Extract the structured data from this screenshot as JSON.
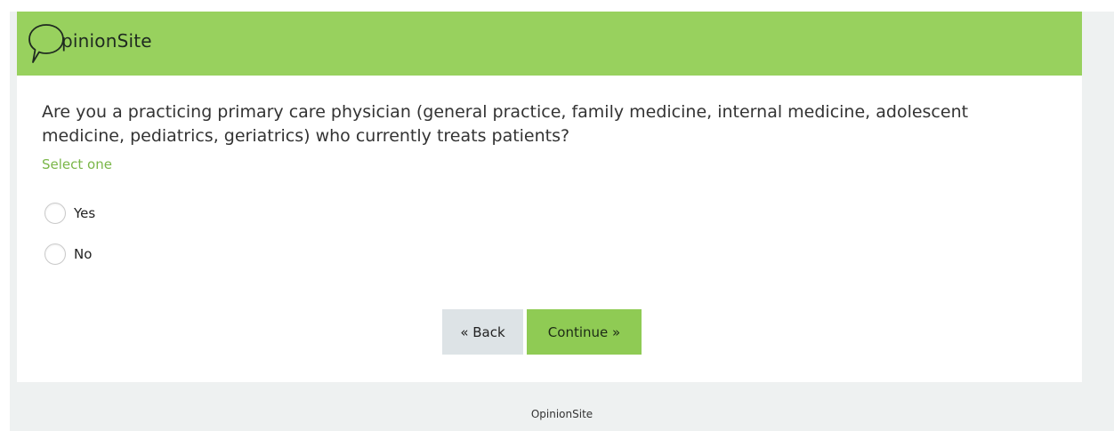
{
  "colors": {
    "header_bg": "#98d15e",
    "accent_text": "#7ab648",
    "continue_bg": "#8fcb54",
    "back_bg": "#dde3e6",
    "page_bg": "#eef1f1"
  },
  "header": {
    "logo_icon": "speech-bubble-icon",
    "logo_text": "pinionSite"
  },
  "question": {
    "text": "Are you a practicing primary care physician (general practice, family medicine, internal medicine, adolescent medicine, pediatrics, geriatrics) who currently treats patients?",
    "hint": "Select one",
    "options": [
      {
        "label": "Yes",
        "selected": false
      },
      {
        "label": "No",
        "selected": false
      }
    ]
  },
  "buttons": {
    "back_label": "« Back",
    "continue_label": "Continue »"
  },
  "footer": {
    "text": "OpinionSite"
  }
}
